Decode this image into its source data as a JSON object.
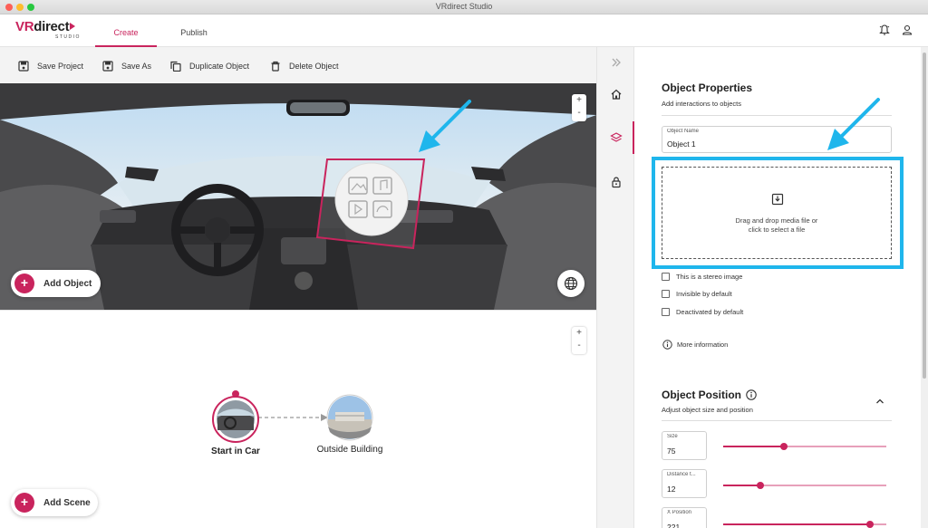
{
  "window": {
    "title": "VRdirect Studio"
  },
  "brand": {
    "name_prefix": "VR",
    "name_suffix": "direct",
    "subtitle": "STUDIO",
    "accent": "#c9245d"
  },
  "header": {
    "tabs": [
      {
        "label": "Create",
        "active": true
      },
      {
        "label": "Publish",
        "active": false
      }
    ]
  },
  "toolbar": {
    "save_project": "Save Project",
    "save_as": "Save As",
    "duplicate_object": "Duplicate Object",
    "delete_object": "Delete Object"
  },
  "viewer": {
    "add_object_label": "Add Object",
    "zoom_in": "+",
    "zoom_out": "-"
  },
  "graph": {
    "zoom_in": "+",
    "zoom_out": "-",
    "add_scene_label": "Add Scene",
    "scenes": [
      {
        "label": "Start in Car",
        "selected": true
      },
      {
        "label": "Outside Building",
        "selected": false
      }
    ]
  },
  "properties": {
    "title": "Object Properties",
    "subtitle": "Add interactions to objects",
    "object_name_label": "Object Name",
    "object_name_value": "Object 1",
    "dropzone_text_1": "Drag and drop media file or",
    "dropzone_text_2": "click to select a file",
    "checkboxes": [
      {
        "label": "This is a stereo image",
        "checked": false
      },
      {
        "label": "Invisible by default",
        "checked": false
      },
      {
        "label": "Deactivated by default",
        "checked": false
      }
    ],
    "more_info": "More information"
  },
  "position": {
    "title": "Object Position",
    "subtitle": "Adjust object size and position",
    "size_label": "Size",
    "size_value": "75",
    "size_fraction": 0.37,
    "distance_label": "Distance t...",
    "distance_value": "12",
    "distance_fraction": 0.23,
    "x_label": "X Position",
    "x_value": "221",
    "x_fraction": 0.9
  },
  "colors": {
    "highlight": "#1fb6ec",
    "accent": "#c9245d"
  }
}
